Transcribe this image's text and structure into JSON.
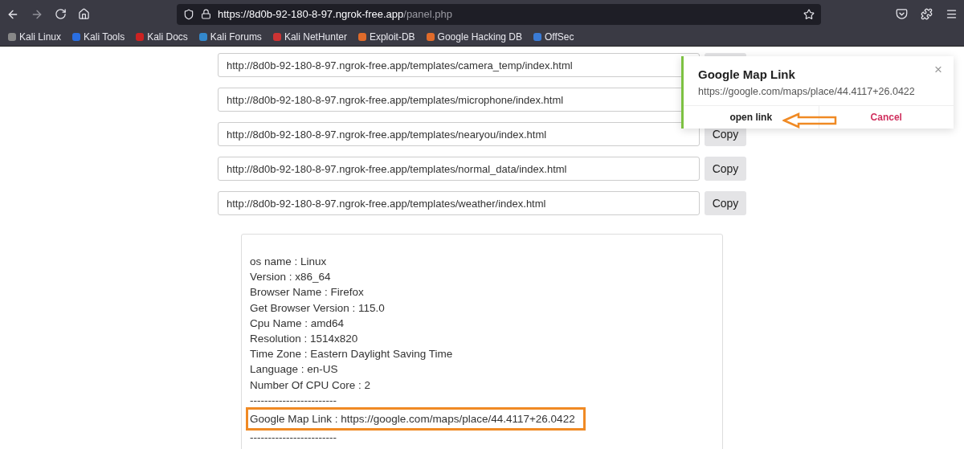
{
  "browser": {
    "url_main": "https://8d0b-92-180-8-97.ngrok-free.app",
    "url_rest": "/panel.php",
    "bookmarks": [
      "Kali Linux",
      "Kali Tools",
      "Kali Docs",
      "Kali Forums",
      "Kali NetHunter",
      "Exploit-DB",
      "Google Hacking DB",
      "OffSec"
    ]
  },
  "links": [
    {
      "url": "http://8d0b-92-180-8-97.ngrok-free.app/templates/camera_temp/index.html"
    },
    {
      "url": "http://8d0b-92-180-8-97.ngrok-free.app/templates/microphone/index.html"
    },
    {
      "url": "http://8d0b-92-180-8-97.ngrok-free.app/templates/nearyou/index.html",
      "copy": "Copy"
    },
    {
      "url": "http://8d0b-92-180-8-97.ngrok-free.app/templates/normal_data/index.html",
      "copy": "Copy"
    },
    {
      "url": "http://8d0b-92-180-8-97.ngrok-free.app/templates/weather/index.html",
      "copy": "Copy"
    }
  ],
  "info_lines": [
    {
      "text": "os name : Linux",
      "highlighted": false
    },
    {
      "text": "Version : x86_64",
      "highlighted": false
    },
    {
      "text": "Browser Name : Firefox",
      "highlighted": false
    },
    {
      "text": "Get Browser Version : 115.0",
      "highlighted": false
    },
    {
      "text": "Cpu Name : amd64",
      "highlighted": false
    },
    {
      "text": "Resolution : 1514x820",
      "highlighted": false
    },
    {
      "text": "Time Zone : Eastern Daylight Saving Time",
      "highlighted": false
    },
    {
      "text": "Language :  en-US",
      "highlighted": false
    },
    {
      "text": "Number Of CPU Core :  2",
      "highlighted": false
    },
    {
      "text": "------------------------",
      "highlighted": false
    },
    {
      "text": "Google Map Link : https://google.com/maps/place/44.4117+26.0422",
      "highlighted": true
    },
    {
      "text": "------------------------",
      "highlighted": false
    }
  ],
  "popup": {
    "title": "Google Map Link",
    "message": "https://google.com/maps/place/44.4117+26.0422",
    "close": "×",
    "confirm": "open link",
    "cancel": "Cancel"
  }
}
